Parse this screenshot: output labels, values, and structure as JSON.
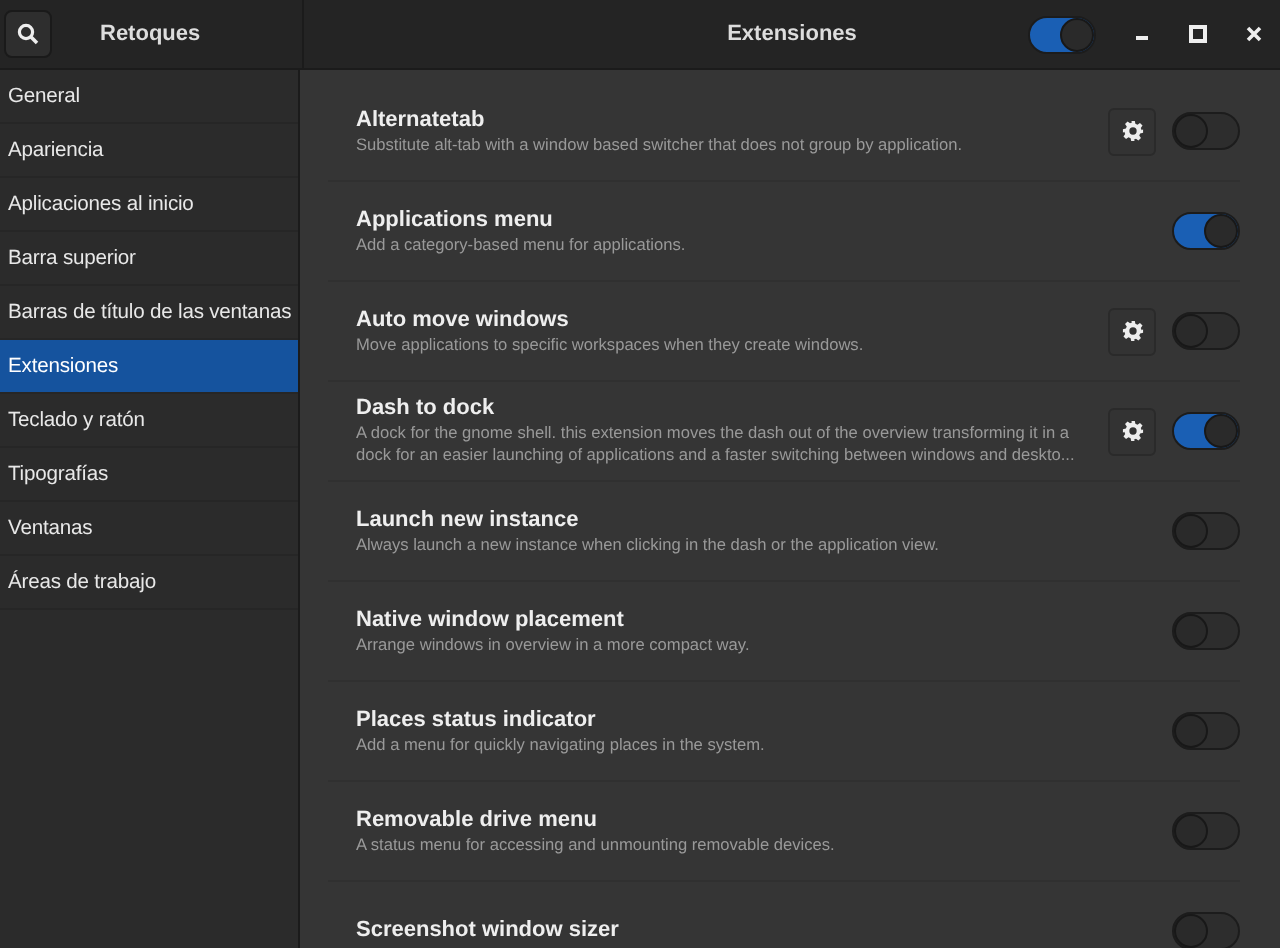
{
  "header": {
    "sidebar_title": "Retoques",
    "title": "Extensiones",
    "master_switch": {
      "on": true
    }
  },
  "sidebar": {
    "items": [
      {
        "label": "General",
        "selected": false
      },
      {
        "label": "Apariencia",
        "selected": false
      },
      {
        "label": "Aplicaciones al inicio",
        "selected": false
      },
      {
        "label": "Barra superior",
        "selected": false
      },
      {
        "label": "Barras de título de las ventanas",
        "selected": false
      },
      {
        "label": "Extensiones",
        "selected": true
      },
      {
        "label": "Teclado y ratón",
        "selected": false
      },
      {
        "label": "Tipografías",
        "selected": false
      },
      {
        "label": "Ventanas",
        "selected": false
      },
      {
        "label": "Áreas de trabajo",
        "selected": false
      }
    ]
  },
  "extensions": [
    {
      "name": "Alternatetab",
      "description": "Substitute alt-tab with a window based switcher that does not group by application.",
      "has_settings": true,
      "on": false
    },
    {
      "name": "Applications menu",
      "description": "Add a category-based menu for applications.",
      "has_settings": false,
      "on": true
    },
    {
      "name": "Auto move windows",
      "description": "Move applications to specific workspaces when they create windows.",
      "has_settings": true,
      "on": false
    },
    {
      "name": "Dash to dock",
      "description": "A dock for the gnome shell. this extension moves the dash out of the overview transforming it in a dock for an easier launching of applications and a faster switching between windows and deskto...",
      "has_settings": true,
      "on": true
    },
    {
      "name": "Launch new instance",
      "description": "Always launch a new instance when clicking in the dash or the application view.",
      "has_settings": false,
      "on": false
    },
    {
      "name": "Native window placement",
      "description": "Arrange windows in overview in a more compact way.",
      "has_settings": false,
      "on": false
    },
    {
      "name": "Places status indicator",
      "description": "Add a menu for quickly navigating places in the system.",
      "has_settings": false,
      "on": false
    },
    {
      "name": "Removable drive menu",
      "description": "A status menu for accessing and unmounting removable devices.",
      "has_settings": false,
      "on": false
    },
    {
      "name": "Screenshot window sizer",
      "has_settings": false,
      "on": false
    }
  ]
}
